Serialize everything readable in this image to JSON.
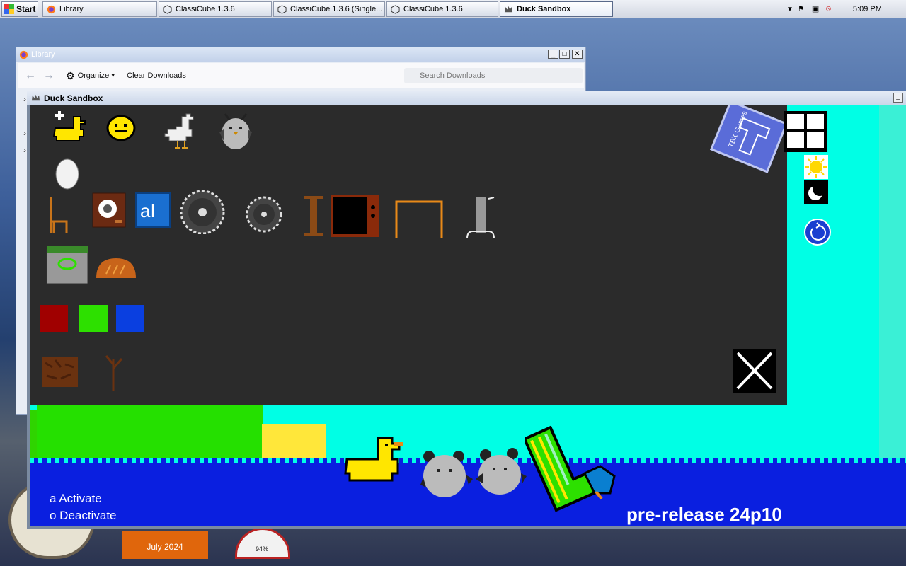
{
  "taskbar": {
    "start_label": "Start",
    "tasks": [
      {
        "label": "Library"
      },
      {
        "label": "ClassiCube 1.3.6"
      },
      {
        "label": "ClassiCube 1.3.6 (Single..."
      },
      {
        "label": "ClassiCube 1.3.6"
      },
      {
        "label": "Duck Sandbox"
      }
    ],
    "clock": "5:09 PM"
  },
  "library": {
    "title": "Library",
    "organize_label": "Organize",
    "clear_label": "Clear Downloads",
    "search_placeholder": "Search Downloads"
  },
  "sandbox": {
    "title": "Duck Sandbox",
    "status_activate": "a Activate",
    "status_deactivate": "o Deactivate",
    "version": "pre-release 24p10",
    "logo_text": "TBX Games",
    "palette_item_names": [
      "duck-adder",
      "chick",
      "goose",
      "owl",
      "egg",
      "chair",
      "speaker",
      "text-tool",
      "saw-blade-large",
      "saw-blade-small",
      "beam",
      "television",
      "table",
      "guitar",
      "trash-can",
      "bread",
      "red-block",
      "green-block",
      "blue-block",
      "dirt",
      "branch"
    ],
    "colors": {
      "red": "#a00000",
      "green": "#2de000",
      "blue": "#0a3fe0",
      "sky": "#00ffe5",
      "water": "#0a1fe0"
    }
  },
  "desktop": {
    "calendar_month": "July 2024",
    "meter_value": "94%"
  }
}
